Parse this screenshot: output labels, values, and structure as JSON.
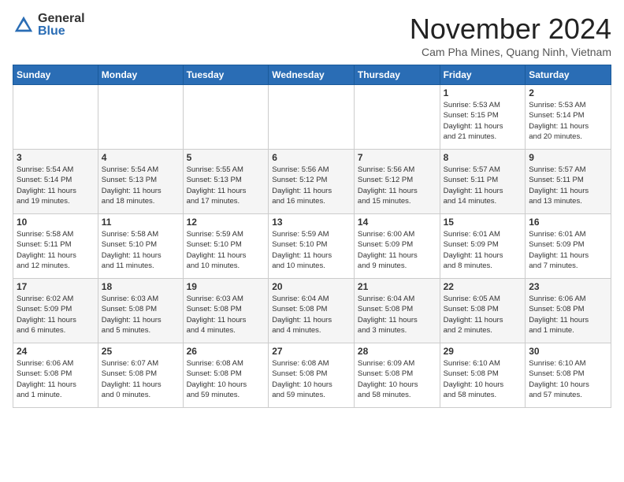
{
  "logo": {
    "general": "General",
    "blue": "Blue"
  },
  "title": "November 2024",
  "location": "Cam Pha Mines, Quang Ninh, Vietnam",
  "headers": [
    "Sunday",
    "Monday",
    "Tuesday",
    "Wednesday",
    "Thursday",
    "Friday",
    "Saturday"
  ],
  "weeks": [
    [
      {
        "day": "",
        "info": ""
      },
      {
        "day": "",
        "info": ""
      },
      {
        "day": "",
        "info": ""
      },
      {
        "day": "",
        "info": ""
      },
      {
        "day": "",
        "info": ""
      },
      {
        "day": "1",
        "info": "Sunrise: 5:53 AM\nSunset: 5:15 PM\nDaylight: 11 hours\nand 21 minutes."
      },
      {
        "day": "2",
        "info": "Sunrise: 5:53 AM\nSunset: 5:14 PM\nDaylight: 11 hours\nand 20 minutes."
      }
    ],
    [
      {
        "day": "3",
        "info": "Sunrise: 5:54 AM\nSunset: 5:14 PM\nDaylight: 11 hours\nand 19 minutes."
      },
      {
        "day": "4",
        "info": "Sunrise: 5:54 AM\nSunset: 5:13 PM\nDaylight: 11 hours\nand 18 minutes."
      },
      {
        "day": "5",
        "info": "Sunrise: 5:55 AM\nSunset: 5:13 PM\nDaylight: 11 hours\nand 17 minutes."
      },
      {
        "day": "6",
        "info": "Sunrise: 5:56 AM\nSunset: 5:12 PM\nDaylight: 11 hours\nand 16 minutes."
      },
      {
        "day": "7",
        "info": "Sunrise: 5:56 AM\nSunset: 5:12 PM\nDaylight: 11 hours\nand 15 minutes."
      },
      {
        "day": "8",
        "info": "Sunrise: 5:57 AM\nSunset: 5:11 PM\nDaylight: 11 hours\nand 14 minutes."
      },
      {
        "day": "9",
        "info": "Sunrise: 5:57 AM\nSunset: 5:11 PM\nDaylight: 11 hours\nand 13 minutes."
      }
    ],
    [
      {
        "day": "10",
        "info": "Sunrise: 5:58 AM\nSunset: 5:11 PM\nDaylight: 11 hours\nand 12 minutes."
      },
      {
        "day": "11",
        "info": "Sunrise: 5:58 AM\nSunset: 5:10 PM\nDaylight: 11 hours\nand 11 minutes."
      },
      {
        "day": "12",
        "info": "Sunrise: 5:59 AM\nSunset: 5:10 PM\nDaylight: 11 hours\nand 10 minutes."
      },
      {
        "day": "13",
        "info": "Sunrise: 5:59 AM\nSunset: 5:10 PM\nDaylight: 11 hours\nand 10 minutes."
      },
      {
        "day": "14",
        "info": "Sunrise: 6:00 AM\nSunset: 5:09 PM\nDaylight: 11 hours\nand 9 minutes."
      },
      {
        "day": "15",
        "info": "Sunrise: 6:01 AM\nSunset: 5:09 PM\nDaylight: 11 hours\nand 8 minutes."
      },
      {
        "day": "16",
        "info": "Sunrise: 6:01 AM\nSunset: 5:09 PM\nDaylight: 11 hours\nand 7 minutes."
      }
    ],
    [
      {
        "day": "17",
        "info": "Sunrise: 6:02 AM\nSunset: 5:09 PM\nDaylight: 11 hours\nand 6 minutes."
      },
      {
        "day": "18",
        "info": "Sunrise: 6:03 AM\nSunset: 5:08 PM\nDaylight: 11 hours\nand 5 minutes."
      },
      {
        "day": "19",
        "info": "Sunrise: 6:03 AM\nSunset: 5:08 PM\nDaylight: 11 hours\nand 4 minutes."
      },
      {
        "day": "20",
        "info": "Sunrise: 6:04 AM\nSunset: 5:08 PM\nDaylight: 11 hours\nand 4 minutes."
      },
      {
        "day": "21",
        "info": "Sunrise: 6:04 AM\nSunset: 5:08 PM\nDaylight: 11 hours\nand 3 minutes."
      },
      {
        "day": "22",
        "info": "Sunrise: 6:05 AM\nSunset: 5:08 PM\nDaylight: 11 hours\nand 2 minutes."
      },
      {
        "day": "23",
        "info": "Sunrise: 6:06 AM\nSunset: 5:08 PM\nDaylight: 11 hours\nand 1 minute."
      }
    ],
    [
      {
        "day": "24",
        "info": "Sunrise: 6:06 AM\nSunset: 5:08 PM\nDaylight: 11 hours\nand 1 minute."
      },
      {
        "day": "25",
        "info": "Sunrise: 6:07 AM\nSunset: 5:08 PM\nDaylight: 11 hours\nand 0 minutes."
      },
      {
        "day": "26",
        "info": "Sunrise: 6:08 AM\nSunset: 5:08 PM\nDaylight: 10 hours\nand 59 minutes."
      },
      {
        "day": "27",
        "info": "Sunrise: 6:08 AM\nSunset: 5:08 PM\nDaylight: 10 hours\nand 59 minutes."
      },
      {
        "day": "28",
        "info": "Sunrise: 6:09 AM\nSunset: 5:08 PM\nDaylight: 10 hours\nand 58 minutes."
      },
      {
        "day": "29",
        "info": "Sunrise: 6:10 AM\nSunset: 5:08 PM\nDaylight: 10 hours\nand 58 minutes."
      },
      {
        "day": "30",
        "info": "Sunrise: 6:10 AM\nSunset: 5:08 PM\nDaylight: 10 hours\nand 57 minutes."
      }
    ]
  ]
}
